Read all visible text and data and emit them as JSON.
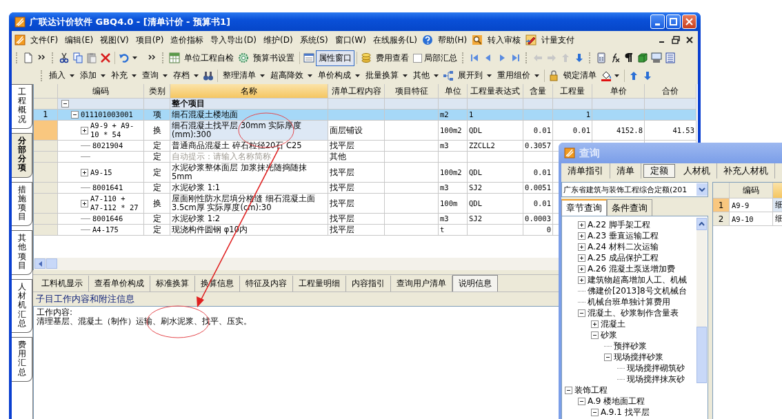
{
  "window": {
    "title": "广联达计价软件 GBQ4.0 - [清单计价 - 预算书1]"
  },
  "menu": [
    {
      "label": "文件(F)"
    },
    {
      "label": "编辑(E)"
    },
    {
      "label": "视图(V)"
    },
    {
      "label": "项目(P)"
    },
    {
      "label": "造价指标"
    },
    {
      "label": "导入导出(D)"
    },
    {
      "label": "维护(D)"
    },
    {
      "label": "系统(S)"
    },
    {
      "label": "窗口(W)"
    },
    {
      "label": "在线服务(L)"
    },
    {
      "label": "帮助(H)"
    },
    {
      "label": "转入审核"
    },
    {
      "label": "计量支付"
    }
  ],
  "toolbar_1": [
    {
      "kind": "button",
      "label": "单位工程自检"
    },
    {
      "kind": "button",
      "label": "预算书设置"
    },
    {
      "kind": "toggle",
      "label": "属性窗口",
      "pressed": true
    },
    {
      "kind": "button",
      "label": "费用查看"
    },
    {
      "kind": "checkbox",
      "label": "局部汇总",
      "checked": false
    }
  ],
  "toolbar_2": [
    {
      "label": "插入",
      "dropdown": true
    },
    {
      "label": "添加",
      "dropdown": true
    },
    {
      "label": "补充",
      "dropdown": true
    },
    {
      "label": "查询",
      "dropdown": true
    },
    {
      "label": "存档",
      "dropdown": true
    },
    {
      "label": "整理清单",
      "dropdown": true
    },
    {
      "label": "超高降效",
      "dropdown": true
    },
    {
      "label": "单价构成",
      "dropdown": true
    },
    {
      "label": "批量换算",
      "dropdown": true
    },
    {
      "label": "其他",
      "dropdown": true
    },
    {
      "label": "展开到",
      "dropdown": true
    },
    {
      "label": "重用组价",
      "dropdown": true
    },
    {
      "label": "锁定清单",
      "dropdown": false
    }
  ],
  "side_tabs": [
    {
      "label": "工程概况",
      "selected": false
    },
    {
      "label": "分部分项",
      "selected": true
    },
    {
      "label": "措施项目",
      "selected": false
    },
    {
      "label": "其他项目",
      "selected": false
    },
    {
      "label": "人材机汇总",
      "selected": false
    },
    {
      "label": "费用汇总",
      "selected": false
    }
  ],
  "table": {
    "columns": [
      {
        "label": "编码",
        "selected": false
      },
      {
        "label": "类别",
        "selected": false
      },
      {
        "label": "名称",
        "selected": true
      },
      {
        "label": "清单工程内容",
        "selected": false
      },
      {
        "label": "项目特征",
        "selected": false
      },
      {
        "label": "单位",
        "selected": false
      },
      {
        "label": "工程量表达式",
        "selected": false
      },
      {
        "label": "含量",
        "selected": false
      },
      {
        "label": "工程量",
        "selected": false
      },
      {
        "label": "单价",
        "selected": false
      },
      {
        "label": "合价",
        "selected": false
      }
    ],
    "rows": [
      {
        "name": "整个项目",
        "expanded": true,
        "selected": false,
        "current": false,
        "children": [
          {
            "number": "1",
            "code": "011101003001",
            "category": "项",
            "name": "细石混凝土楼地面",
            "unit": "m2",
            "expression": "1",
            "quantity": "1",
            "expanded": true,
            "selected": true,
            "current": false,
            "children": [
              {
                "code": "A9-9 + A9-10 * 54",
                "category": "换",
                "name": "细石混凝土找平层 30mm 实际厚度(mm):300",
                "content": "面层铺设",
                "unit": "100m2",
                "expression": "QDL",
                "ratio": "0.01",
                "quantity": "0.01",
                "price": "4152.8",
                "total": "41.53",
                "expanded": false,
                "selected": false,
                "current": true
              },
              {
                "code": "8021904",
                "category": "定",
                "name": "普通商品混凝土 碎石粒径20石 C25",
                "content": "找平层",
                "unit": "m3",
                "expression": "ZZCLL2",
                "ratio": "0.3057",
                "selected": false,
                "current": false
              },
              {
                "category": "定",
                "placeholder": "自动提示：请输入名称简称",
                "content": "其他",
                "selected": false,
                "current": false
              },
              {
                "code": "A9-15",
                "category": "定",
                "name": "水泥砂浆整体面层 加浆抹光随捣随抹 5mm",
                "content": "找平层",
                "unit": "100m2",
                "expression": "QDL",
                "ratio": "0.01",
                "expanded": false,
                "selected": false,
                "current": false
              },
              {
                "code": "8001641",
                "category": "定",
                "name": "水泥砂浆 1:1",
                "content": "找平层",
                "unit": "m3",
                "expression": "SJ2",
                "ratio": "0.0051",
                "selected": false,
                "current": false
              },
              {
                "code": "A7-110 + A7-112 * 27",
                "category": "换",
                "name": "屋面刚性防水层填分格缝 细石混凝土面 3.5cm厚 实际厚度(cm):30",
                "content": "找平层",
                "unit": "100m",
                "expression": "QDL",
                "ratio": "0.01",
                "expanded": false,
                "selected": false,
                "current": false
              },
              {
                "code": "8001646",
                "category": "定",
                "name": "水泥砂浆 1:2",
                "content": "找平层",
                "unit": "m3",
                "expression": "SJ2",
                "ratio": "0.0003",
                "selected": false,
                "current": false
              },
              {
                "code": "A4-175",
                "category": "定",
                "name": "现浇构件圆钢 φ10内",
                "content": "找平层",
                "unit": "t",
                "ratio": "0",
                "selected": false,
                "current": false
              }
            ]
          }
        ]
      }
    ]
  },
  "bottom_tabs": [
    {
      "label": "工料机显示",
      "selected": false
    },
    {
      "label": "查看单价构成",
      "selected": false
    },
    {
      "label": "标准换算",
      "selected": false
    },
    {
      "label": "换算信息",
      "selected": false
    },
    {
      "label": "特征及内容",
      "selected": false
    },
    {
      "label": "工程量明细",
      "selected": false
    },
    {
      "label": "内容指引",
      "selected": false
    },
    {
      "label": "查询用户清单",
      "selected": false
    },
    {
      "label": "说明信息",
      "selected": true
    }
  ],
  "info": {
    "title": "子目工作内容和附注信息",
    "lines": [
      "工作内容:",
      "清理基层、混凝土（制作）运输、刷水泥浆、找平、压实。"
    ]
  },
  "query_window": {
    "title": "查询",
    "tabs": [
      {
        "label": "清单指引",
        "selected": false
      },
      {
        "label": "清单",
        "selected": false
      },
      {
        "label": "定额",
        "selected": true
      },
      {
        "label": "人材机",
        "selected": false
      },
      {
        "label": "补充人材机",
        "selected": false
      }
    ],
    "library": "广东省建筑与装饰工程综合定额(201",
    "subtabs": [
      {
        "label": "章节查询",
        "selected": true
      },
      {
        "label": "条件查询",
        "selected": false
      }
    ],
    "tree": [
      {
        "children": [
          {
            "label": "A.22 脚手架工程",
            "expanded": false
          },
          {
            "label": "A.23 垂直运输工程",
            "expanded": false
          },
          {
            "label": "A.24 材料二次运输",
            "expanded": false
          },
          {
            "label": "A.25 成品保护工程",
            "expanded": false
          },
          {
            "label": "A.26 混凝土泵送增加费",
            "expanded": false
          },
          {
            "label": "建筑物超高增加人工、机械",
            "expanded": false
          },
          {
            "label": "佛建价[2013]8号文机械台"
          },
          {
            "label": "机械台班单独计算费用"
          },
          {
            "label": "混凝土、砂浆制作含量表",
            "expanded": true,
            "children": [
              {
                "label": "混凝土",
                "expanded": false
              },
              {
                "label": "砂浆",
                "expanded": true,
                "children": [
                  {
                    "label": "预拌砂浆"
                  },
                  {
                    "label": "现场搅拌砂浆",
                    "expanded": true,
                    "children": [
                      {
                        "label": "现场搅拌砌筑砂"
                      },
                      {
                        "label": "现场搅拌抹灰砂"
                      }
                    ]
                  }
                ]
              }
            ]
          }
        ]
      },
      {
        "label": "装饰工程",
        "expanded": true,
        "children": [
          {
            "label": "A.9 楼地面工程",
            "expanded": true,
            "children": [
              {
                "label": "A.9.1 找平层",
                "expanded": true
              }
            ]
          }
        ]
      }
    ],
    "grid": {
      "columns": [
        "编码"
      ],
      "rows": [
        {
          "number": "1",
          "code": "A9-9",
          "column_3": "细",
          "current": true
        },
        {
          "number": "2",
          "code": "A9-10",
          "column_3": "细",
          "current": false
        }
      ]
    }
  }
}
